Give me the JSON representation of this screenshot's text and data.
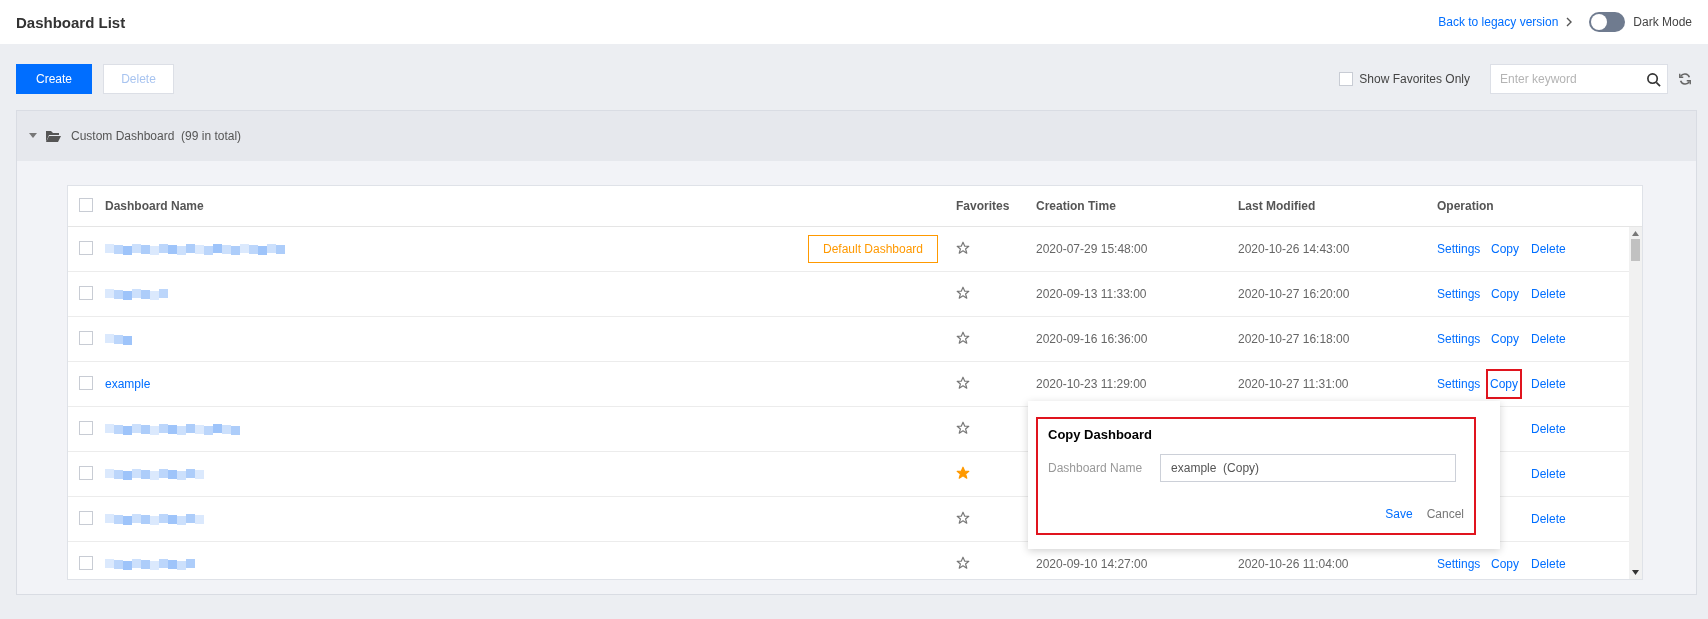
{
  "header": {
    "title": "Dashboard List",
    "legacy_link": "Back to legacy version",
    "dark_mode": {
      "label": "Dark Mode",
      "on": false
    }
  },
  "toolbar": {
    "create": "Create",
    "delete": {
      "label": "Delete",
      "disabled": true
    },
    "favorites_only": {
      "label": "Show Favorites Only",
      "checked": false
    },
    "search": {
      "placeholder": "Enter keyword"
    }
  },
  "group": {
    "name": "Custom Dashboard",
    "count": "(99 in total)",
    "expanded": true
  },
  "table": {
    "select_all_checked": false,
    "columns": [
      "Dashboard Name",
      "Favorites",
      "Creation Time",
      "Last Modified",
      "Operation"
    ],
    "rows": [
      {
        "redacted": true,
        "checked": false,
        "badge": "Default Dashboard",
        "favorite": false,
        "created": "2020-07-29 15:48:00",
        "modified": "2020-10-26 14:43:00",
        "operations": [
          {
            "kind": "settings",
            "label": "Settings",
            "highlighted": false
          },
          {
            "kind": "copy",
            "label": "Copy",
            "highlighted": false
          },
          {
            "kind": "delete",
            "label": "Delete",
            "highlighted": false
          }
        ]
      },
      {
        "redacted": true,
        "checked": false,
        "favorite": false,
        "created": "2020-09-13 11:33:00",
        "modified": "2020-10-27 16:20:00",
        "operations": [
          {
            "kind": "settings",
            "label": "Settings",
            "highlighted": false
          },
          {
            "kind": "copy",
            "label": "Copy",
            "highlighted": false
          },
          {
            "kind": "delete",
            "label": "Delete",
            "highlighted": false
          }
        ]
      },
      {
        "redacted": true,
        "checked": false,
        "favorite": false,
        "created": "2020-09-16 16:36:00",
        "modified": "2020-10-27 16:18:00",
        "operations": [
          {
            "kind": "settings",
            "label": "Settings",
            "highlighted": false
          },
          {
            "kind": "copy",
            "label": "Copy",
            "highlighted": false
          },
          {
            "kind": "delete",
            "label": "Delete",
            "highlighted": false
          }
        ]
      },
      {
        "redacted": false,
        "checked": false,
        "name": "example",
        "favorite": false,
        "created": "2020-10-23 11:29:00",
        "modified": "2020-10-27 11:31:00",
        "operations": [
          {
            "kind": "settings",
            "label": "Settings",
            "highlighted": false
          },
          {
            "kind": "copy",
            "label": "Copy",
            "highlighted": true
          },
          {
            "kind": "delete",
            "label": "Delete",
            "highlighted": false
          }
        ]
      },
      {
        "redacted": true,
        "checked": false,
        "favorite": false,
        "operations": [
          {
            "kind": "delete",
            "label": "Delete",
            "highlighted": false
          }
        ]
      },
      {
        "redacted": true,
        "checked": false,
        "favorite": true,
        "operations": [
          {
            "kind": "delete",
            "label": "Delete",
            "highlighted": false
          }
        ]
      },
      {
        "redacted": true,
        "checked": false,
        "favorite": false,
        "operations": [
          {
            "kind": "delete",
            "label": "Delete",
            "highlighted": false
          }
        ]
      },
      {
        "redacted": true,
        "checked": false,
        "favorite": false,
        "created": "2020-09-10 14:27:00",
        "modified": "2020-10-26 11:04:00",
        "operations": [
          {
            "kind": "settings",
            "label": "Settings",
            "highlighted": false
          },
          {
            "kind": "copy",
            "label": "Copy",
            "highlighted": false
          },
          {
            "kind": "delete",
            "label": "Delete",
            "highlighted": false
          }
        ]
      }
    ]
  },
  "copy_dialog": {
    "title": "Copy Dashboard",
    "field_label": "Dashboard Name",
    "value": "example  (Copy)",
    "save": "Save",
    "cancel": "Cancel",
    "highlighted": true
  }
}
